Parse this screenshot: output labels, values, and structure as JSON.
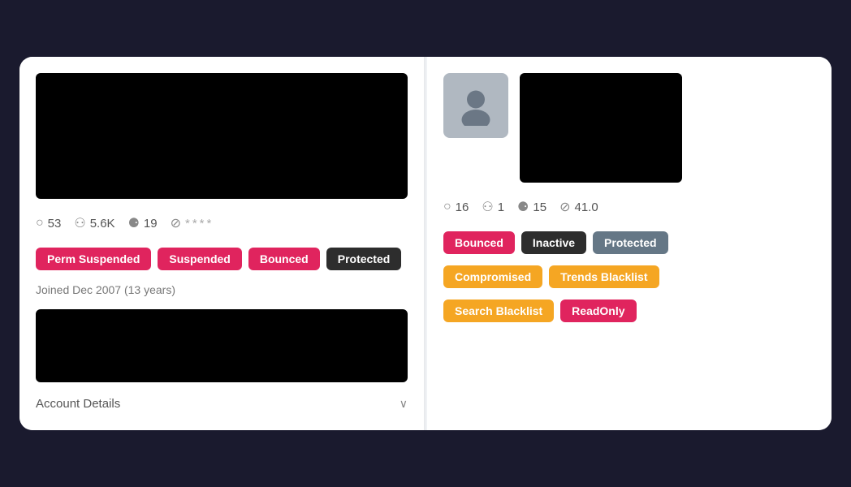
{
  "left_panel": {
    "stats": {
      "comments": "53",
      "followers": "5.6K",
      "following": "19",
      "score": "****"
    },
    "tags": [
      {
        "label": "Perm Suspended",
        "color": "red"
      },
      {
        "label": "Suspended",
        "color": "red"
      },
      {
        "label": "Bounced",
        "color": "red"
      },
      {
        "label": "Protected",
        "color": "dark"
      }
    ],
    "joined": "Joined Dec 2007 (13 years)",
    "account_details": "Account Details"
  },
  "right_panel": {
    "stats": {
      "comments": "16",
      "followers": "1",
      "following": "15",
      "score": "41.0"
    },
    "tags_row1": [
      {
        "label": "Bounced",
        "color": "red"
      },
      {
        "label": "Inactive",
        "color": "dark"
      },
      {
        "label": "Protected",
        "color": "gray"
      }
    ],
    "tags_row2": [
      {
        "label": "Compromised",
        "color": "orange"
      },
      {
        "label": "Trends Blacklist",
        "color": "orange"
      }
    ],
    "tags_row3": [
      {
        "label": "Search Blacklist",
        "color": "orange"
      },
      {
        "label": "ReadOnly",
        "color": "red"
      }
    ]
  },
  "icons": {
    "comment": "○",
    "followers": "⚇",
    "following": "⚈",
    "block": "⊘",
    "chevron": "∨"
  }
}
